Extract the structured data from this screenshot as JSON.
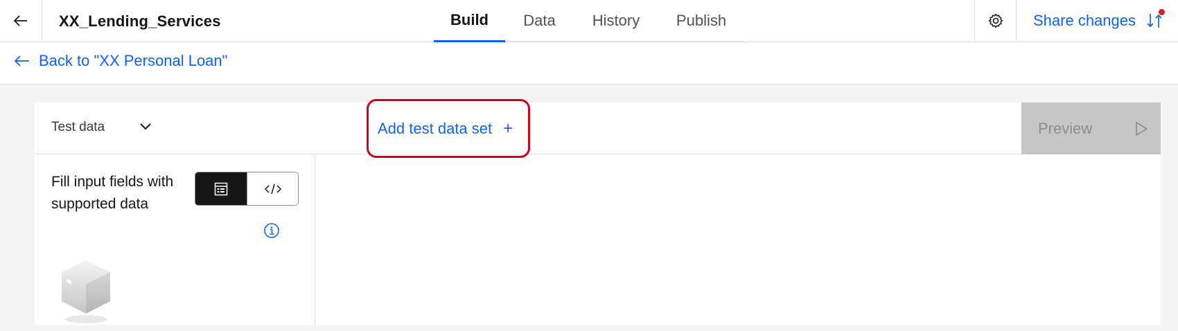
{
  "header": {
    "title": "XX_Lending_Services",
    "tabs": [
      {
        "label": "Build",
        "active": true
      },
      {
        "label": "Data",
        "active": false
      },
      {
        "label": "History",
        "active": false
      },
      {
        "label": "Publish",
        "active": false
      }
    ],
    "share_label": "Share changes",
    "icons": {
      "back": "arrow-left-icon",
      "settings": "gear-icon",
      "share": "swap-arrows-icon"
    }
  },
  "breadcrumb": {
    "back_label": "Back to \"XX Personal Loan\""
  },
  "toolbar": {
    "dropdown_label": "Test data",
    "add_set_label": "Add test data set",
    "add_set_icon": "+",
    "preview_label": "Preview"
  },
  "left_panel": {
    "instruction": "Fill input fields with supported data",
    "toggle": {
      "selected": "form-view",
      "options": [
        "form-view-icon",
        "code-view-icon"
      ]
    },
    "info_icon": "information-icon"
  },
  "colors": {
    "accent": "#0f62fe",
    "highlight": "#d0021b",
    "notification_dot": "#da1e28",
    "disabled_bg": "#c6c6c6"
  }
}
